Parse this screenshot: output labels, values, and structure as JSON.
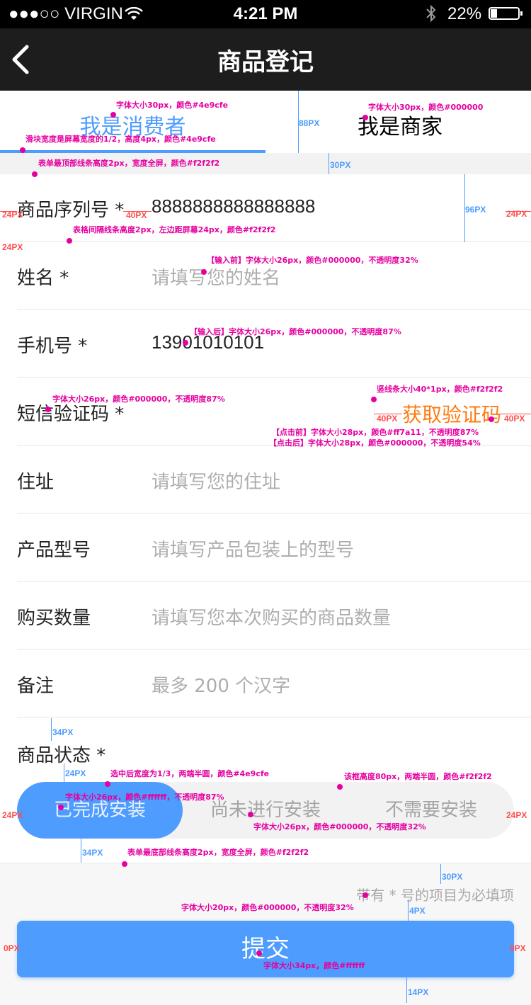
{
  "statusbar": {
    "carrier": "●●●○○ VIRGIN",
    "time": "4:21 PM",
    "battery": "22%",
    "battery_level": 0.22,
    "bluetooth_icon": "bluetooth-icon",
    "wifi_icon": "wifi-icon"
  },
  "navbar": {
    "title": "商品登记",
    "back_icon": "chevron-left-icon"
  },
  "tabs": [
    {
      "label": "我是消费者",
      "active": true
    },
    {
      "label": "我是商家",
      "active": false
    }
  ],
  "form": {
    "serial": {
      "label": "商品序列号 *",
      "value": "8888888888888888"
    },
    "name": {
      "label": "姓名 *",
      "placeholder": "请填写您的姓名"
    },
    "phone": {
      "label": "手机号 *",
      "value": "13901010101"
    },
    "sms": {
      "label": "短信验证码 *",
      "action": "获取验证码"
    },
    "address": {
      "label": "住址",
      "placeholder": "请填写您的住址"
    },
    "model": {
      "label": "产品型号",
      "placeholder": "请填写产品包装上的型号"
    },
    "quantity": {
      "label": "购买数量",
      "placeholder": "请填写您本次购买的商品数量"
    },
    "note": {
      "label": "备注",
      "placeholder": "最多 200 个汉字"
    },
    "status": {
      "label": "商品状态 *",
      "options": [
        "已完成安装",
        "尚未进行安装",
        "不需要安装"
      ],
      "selected": 0
    }
  },
  "hint": "带有 * 号的项目为必填项",
  "submit": "提交",
  "colors": {
    "accent": "#4e9cfe",
    "divider": "#f2f2f2",
    "orange": "#ff7a11",
    "annotation": "#e600a0"
  },
  "annotations": {
    "a1": "字体大小30px，颜色#4e9cfe",
    "a2": "字体大小30px，颜色#000000",
    "a3": "滑块宽度是屏幕宽度的1/2，高度4px，颜色#4e9cfe",
    "a4": "表单最顶部线条高度2px，宽度全屏，颜色#f2f2f2",
    "a5": "表格间隔线条高度2px，左边距屏幕24px，颜色#f2f2f2",
    "a6": "【输入前】字体大小26px，颜色#000000，不透明度32%",
    "a7": "【输入后】字体大小26px，颜色#000000，不透明度87%",
    "a8": "字体大小26px，颜色#000000，不透明度87%",
    "a9": "竖线条大小40*1px，颜色#f2f2f2",
    "a10": "【点击前】字体大小28px，颜色#ff7a11，不透明度87%",
    "a11": "【点击后】字体大小28px，颜色#000000，不透明度54%",
    "a12": "选中后宽度为1/3，两端半圆，颜色#4e9cfe",
    "a13": "该框高度80px，两端半圆，颜色#f2f2f2",
    "a14": "字体大小26px，颜色#ffffff，不透明度87%",
    "a15": "字体大小26px，颜色#000000，不透明度32%",
    "a16": "表单最底部线条高度2px，宽度全屏，颜色#f2f2f2",
    "a17": "字体大小20px，颜色#000000，不透明度32%",
    "a18": "字体大小34px，颜色#ffffff",
    "d88": "88PX",
    "d30": "30PX",
    "d96": "96PX",
    "d24": "24PX",
    "d40": "40PX",
    "d34": "34PX",
    "d4": "4PX",
    "d14": "14PX",
    "d0": "0PX"
  }
}
